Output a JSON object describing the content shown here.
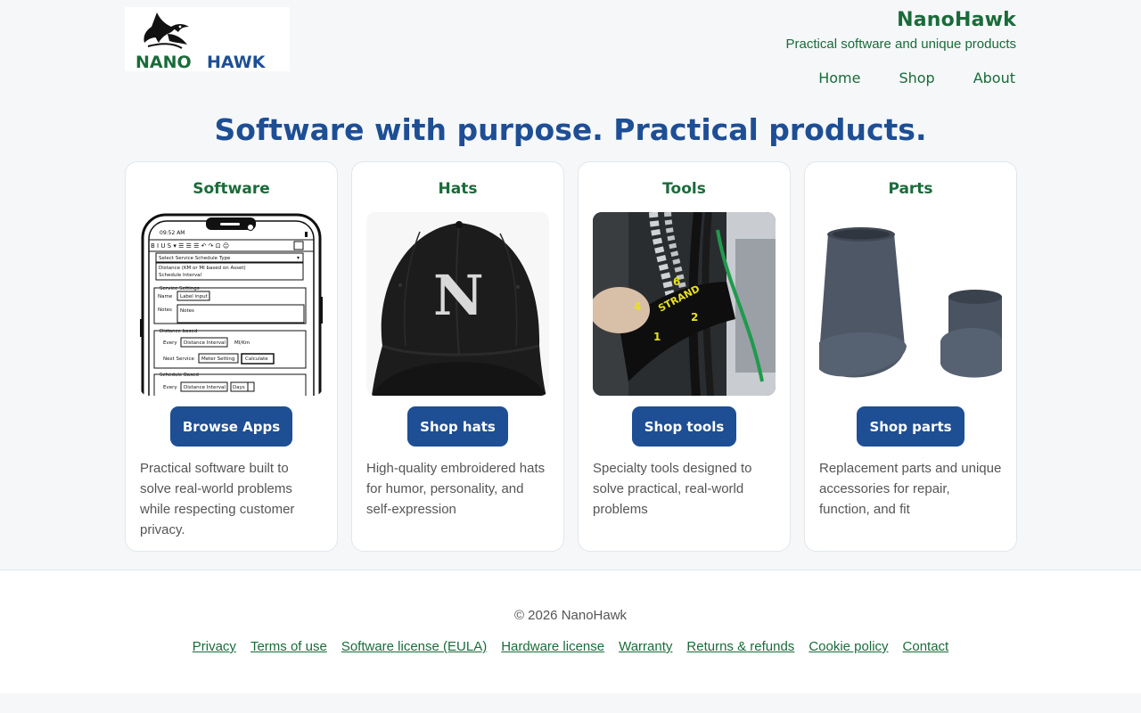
{
  "header": {
    "logo_text": "NANOHAWK",
    "brand_name": "NanoHawk",
    "tagline": "Practical software and unique products",
    "nav": [
      {
        "label": "Home"
      },
      {
        "label": "Shop"
      },
      {
        "label": "About"
      }
    ]
  },
  "hero": {
    "title": "Software with purpose. Practical products."
  },
  "cards": [
    {
      "title": "Software",
      "button": "Browse Apps",
      "description": "Practical software built to solve real-world problems while respecting customer privacy.",
      "image": "phone-app-mockup"
    },
    {
      "title": "Hats",
      "button": "Shop hats",
      "description": "High-quality embroidered hats for humor, personality, and self-expression",
      "image": "black-cap-with-N"
    },
    {
      "title": "Tools",
      "button": "Shop tools",
      "description": "Specialty tools designed to solve practical, real-world problems",
      "image": "strand-marker-tool"
    },
    {
      "title": "Parts",
      "button": "Shop parts",
      "description": "Replacement parts and unique accessories for repair, function, and fit",
      "image": "grey-cylindrical-caps"
    }
  ],
  "mockup": {
    "time": "09:52 AM",
    "select_label": "Select Service Schedule Type",
    "option_1": "Distance (KM or MI based on Asset)",
    "option_2": "Schedule Interval",
    "group_1": "Service Settings",
    "name_label": "Name",
    "name_input": "Label input",
    "notes_label": "Notes",
    "notes_input": "Notes",
    "group_2": "Distance based",
    "every_label": "Every",
    "distance_input": "Distance Interval",
    "unit": "MI/Km",
    "next_label": "Next Service",
    "meter_input": "Meter Setting",
    "calc_button": "Calculate",
    "group_3": "Schedule Based",
    "every_label_2": "Every",
    "distance_input_2": "Distance Interval",
    "days_select": "Days"
  },
  "tool_labels": {
    "n1": "4",
    "n2": "6",
    "n3": "STRAND",
    "n4": "2",
    "n5": "1"
  },
  "hat_letter": "N",
  "footer": {
    "copyright": "© 2026 NanoHawk",
    "links": [
      {
        "label": "Privacy"
      },
      {
        "label": "Terms of use"
      },
      {
        "label": "Software license (EULA)"
      },
      {
        "label": "Hardware license"
      },
      {
        "label": "Warranty"
      },
      {
        "label": "Returns & refunds"
      },
      {
        "label": "Cookie policy"
      },
      {
        "label": "Contact"
      }
    ]
  },
  "colors": {
    "brand_green": "#1a6b3a",
    "brand_blue": "#1e4e94",
    "background": "#f5f7f9"
  }
}
